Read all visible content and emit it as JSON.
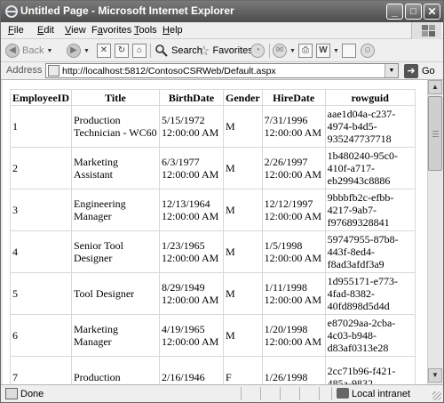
{
  "window": {
    "title": "Untitled Page - Microsoft Internet Explorer",
    "buttons": {
      "minimize": "_",
      "maximize": "□",
      "close": "✕"
    }
  },
  "menu": [
    {
      "label_pre": "",
      "accel": "F",
      "label_post": "ile"
    },
    {
      "label_pre": "",
      "accel": "E",
      "label_post": "dit"
    },
    {
      "label_pre": "",
      "accel": "V",
      "label_post": "iew"
    },
    {
      "label_pre": "F",
      "accel": "a",
      "label_post": "vorites"
    },
    {
      "label_pre": "",
      "accel": "T",
      "label_post": "ools"
    },
    {
      "label_pre": "",
      "accel": "H",
      "label_post": "elp"
    }
  ],
  "toolbar": {
    "back": "Back",
    "search": "Search",
    "favorites": "Favorites"
  },
  "address": {
    "label": "Address",
    "url": "http://localhost:5812/ContosoCSRWeb/Default.aspx",
    "go": "Go"
  },
  "table": {
    "headers": [
      "EmployeeID",
      "Title",
      "BirthDate",
      "Gender",
      "HireDate",
      "rowguid"
    ],
    "rows": [
      {
        "id": "1",
        "title": "Production Technician - WC60",
        "birth": "5/15/1972 12:00:00 AM",
        "gender": "M",
        "hire": "7/31/1996 12:00:00 AM",
        "guid": "aae1d04a-c237-4974-b4d5-935247737718"
      },
      {
        "id": "2",
        "title": "Marketing Assistant",
        "birth": "6/3/1977 12:00:00 AM",
        "gender": "M",
        "hire": "2/26/1997 12:00:00 AM",
        "guid": "1b480240-95c0-410f-a717-eb29943c8886"
      },
      {
        "id": "3",
        "title": "Engineering Manager",
        "birth": "12/13/1964 12:00:00 AM",
        "gender": "M",
        "hire": "12/12/1997 12:00:00 AM",
        "guid": "9bbbfb2c-efbb-4217-9ab7-f97689328841"
      },
      {
        "id": "4",
        "title": "Senior Tool Designer",
        "birth": "1/23/1965 12:00:00 AM",
        "gender": "M",
        "hire": "1/5/1998 12:00:00 AM",
        "guid": "59747955-87b8-443f-8ed4-f8ad3afdf3a9"
      },
      {
        "id": "5",
        "title": "Tool Designer",
        "birth": "8/29/1949 12:00:00 AM",
        "gender": "M",
        "hire": "1/11/1998 12:00:00 AM",
        "guid": "1d955171-e773-4fad-8382-40fd898d5d4d"
      },
      {
        "id": "6",
        "title": "Marketing Manager",
        "birth": "4/19/1965 12:00:00 AM",
        "gender": "M",
        "hire": "1/20/1998 12:00:00 AM",
        "guid": "e87029aa-2cba-4c03-b948-d83af0313e28"
      },
      {
        "id": "7",
        "title": "Production",
        "birth": "2/16/1946",
        "gender": "F",
        "hire": "1/26/1998",
        "guid": "2cc71b96-f421-485a-9832"
      }
    ]
  },
  "status": {
    "text": "Done",
    "zone": "Local intranet"
  }
}
